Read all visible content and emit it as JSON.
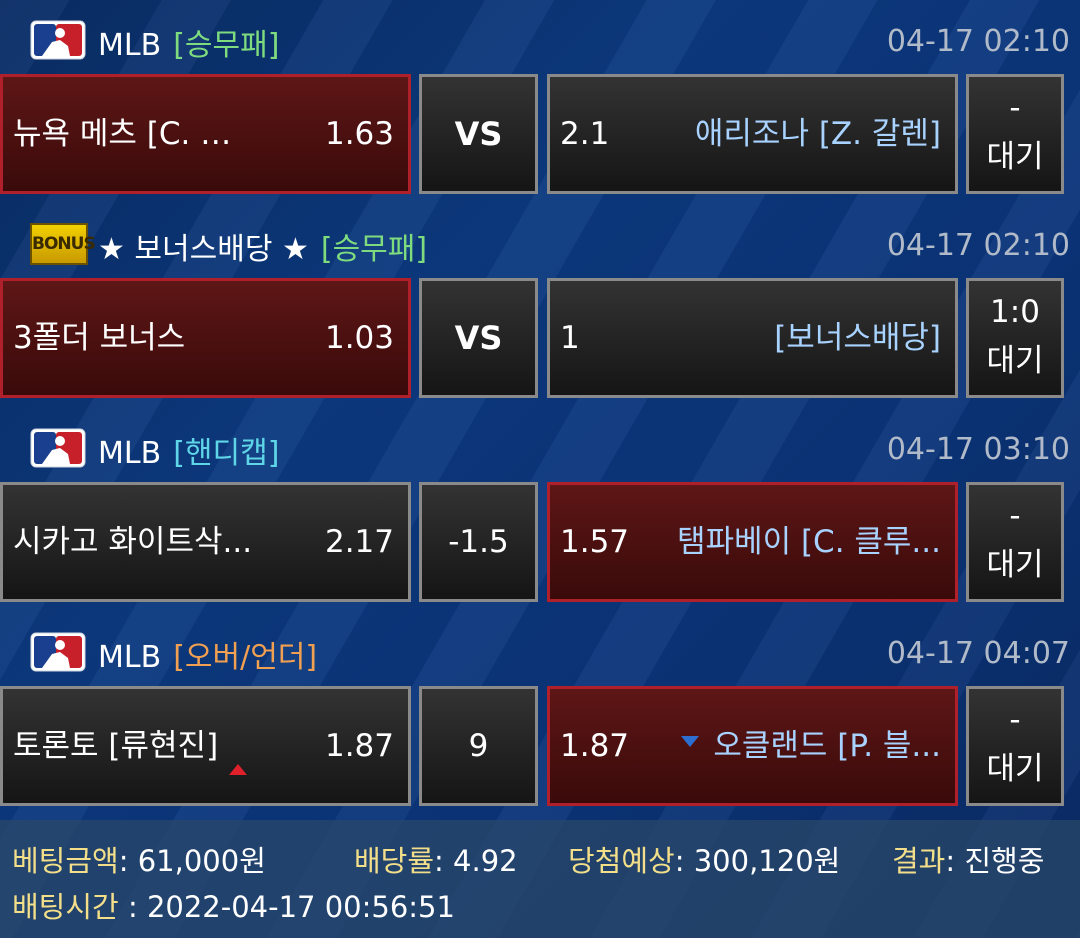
{
  "bets": [
    {
      "league": "MLB",
      "type": "[승무패]",
      "type_color": "green",
      "time": "04-17 02:10",
      "home": {
        "name": "뉴욕 메츠 [C. 카...",
        "odds": "1.63"
      },
      "middle": "VS",
      "away": {
        "name": "애리조나 [Z. 갈렌]",
        "odds": "2.1"
      },
      "result": {
        "score": "-",
        "status": "대기"
      },
      "selected": "home"
    },
    {
      "league": "★ 보너스배당 ★",
      "league_icon": "BONUS",
      "type": "[승무패]",
      "type_color": "green",
      "time": "04-17 02:10",
      "home": {
        "name": "3폴더 보너스",
        "odds": "1.03"
      },
      "middle": "VS",
      "away": {
        "name": "[보너스배당]",
        "odds": "1"
      },
      "result": {
        "score": "1:0",
        "status": "대기"
      },
      "selected": "home"
    },
    {
      "league": "MLB",
      "type": "[핸디캡]",
      "type_color": "cyan",
      "time": "04-17 03:10",
      "home": {
        "name": "시카고 화이트삭...",
        "odds": "2.17"
      },
      "middle": "-1.5",
      "away": {
        "name": "탬파베이 [C. 클루...",
        "odds": "1.57"
      },
      "result": {
        "score": "-",
        "status": "대기"
      },
      "selected": "away"
    },
    {
      "league": "MLB",
      "type": "[오버/언더]",
      "type_color": "orange",
      "time": "04-17 04:07",
      "home": {
        "name": "토론토 [류현진]",
        "odds": "1.87",
        "indicator": "up-arrow-icon"
      },
      "middle": "9",
      "away": {
        "name": "오클랜드 [P. 블...",
        "odds": "1.87",
        "indicator": "down-arrow-icon"
      },
      "result": {
        "score": "-",
        "status": "대기"
      },
      "selected": "away"
    }
  ],
  "summary": {
    "amount_label": "베팅금액",
    "amount_value": ": 61,000원",
    "rate_label": "배당률",
    "rate_value": ": 4.92",
    "expected_label": "당첨예상",
    "expected_value": ": 300,120원",
    "result_label": "결과",
    "result_value": ": 진행중",
    "time_label": "배팅시간",
    "time_value": " : 2022-04-17 00:56:51"
  },
  "colors": {
    "selected_border": "#b0202a",
    "selected_bg": "#5e1616",
    "type_green": "#7edc7e",
    "type_cyan": "#5fd6e8",
    "type_orange": "#f0a050",
    "summary_label": "#f3df8a"
  }
}
